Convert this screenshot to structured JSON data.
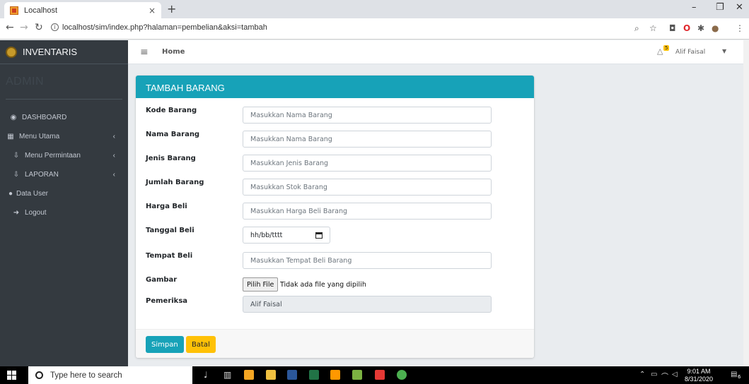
{
  "browser": {
    "tab_title": "Localhost",
    "tab_close": "×",
    "new_tab": "+",
    "url": "localhost/sim/index.php?halaman=pembelian&aksi=tambah",
    "win_min": "–",
    "win_max": "❐",
    "win_close": "✕"
  },
  "sidebar": {
    "brand": "INVENTARIS",
    "user_panel": "ADMIN",
    "items": [
      {
        "label": "DASHBOARD",
        "icon": "dashboard-icon",
        "glyph": "◉"
      },
      {
        "label": "Menu Utama",
        "icon": "table-icon",
        "glyph": "▦",
        "arrow": "‹"
      },
      {
        "label": "Menu Permintaan",
        "icon": "download-icon",
        "glyph": "⇩",
        "arrow": "‹"
      },
      {
        "label": "LAPORAN",
        "icon": "download-icon",
        "glyph": "⇩",
        "arrow": "‹"
      },
      {
        "label": "Data User",
        "icon": "user-icon",
        "glyph": "●"
      },
      {
        "label": "Logout",
        "icon": "sign-out-icon",
        "glyph": "➜"
      }
    ]
  },
  "topnav": {
    "menu_glyph": "≡",
    "home": "Home",
    "notif_count": "5",
    "bell_glyph": "△",
    "user": "Alif Faisal",
    "caret": "▼"
  },
  "form": {
    "title": "TAMBAH BARANG",
    "fields": [
      {
        "label": "Kode Barang",
        "placeholder": "Masukkan Nama Barang"
      },
      {
        "label": "Nama Barang",
        "placeholder": "Masukkan Nama Barang"
      },
      {
        "label": "Jenis Barang",
        "placeholder": "Masukkan Jenis Barang"
      },
      {
        "label": "Jumlah Barang",
        "placeholder": "Masukkan Stok  Barang"
      },
      {
        "label": "Harga Beli",
        "placeholder": "Masukkan Harga Beli Barang"
      }
    ],
    "tanggal": {
      "label": "Tanggal Beli",
      "value": "hh/bb/tttt"
    },
    "tempat": {
      "label": "Tempat Beli",
      "placeholder": "Masukkan Tempat Beli Barang"
    },
    "gambar": {
      "label": "Gambar",
      "button": "Pilih File",
      "status": "Tidak ada file yang dipilih"
    },
    "pemeriksa": {
      "label": "Pemeriksa",
      "value": "Alif Faisal"
    },
    "save": "Simpan",
    "cancel": "Batal"
  },
  "taskbar": {
    "search": "Type here to search",
    "time": "9:01 AM",
    "date": "8/31/2020",
    "notif_count": "6"
  },
  "colors": {
    "primary": "#17a2b8",
    "warning": "#ffc107",
    "sidebar": "#343a40"
  }
}
